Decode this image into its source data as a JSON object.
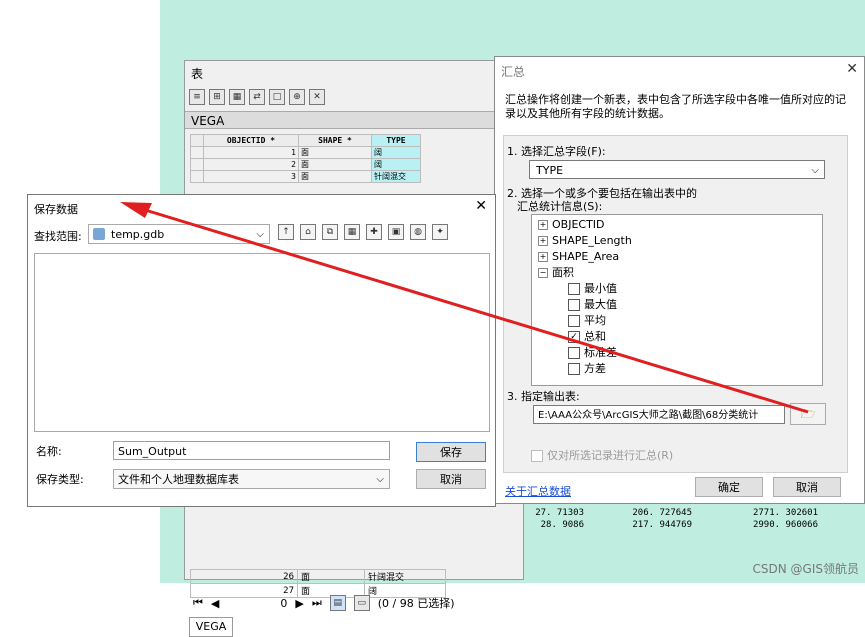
{
  "table_window": {
    "title": "表",
    "layer_name": "VEGA",
    "columns": [
      "OBJECTID *",
      "SHAPE *",
      "TYPE"
    ],
    "rows": [
      [
        "1",
        "面",
        "阔"
      ],
      [
        "2",
        "面",
        "阔"
      ],
      [
        "3",
        "面",
        "针阔混交"
      ]
    ],
    "bottom_rows": [
      [
        "26",
        "面",
        "针阔混交",
        "27. 71303",
        "206. 727645",
        "2771. 302601"
      ],
      [
        "27",
        "面",
        "阔",
        "28. 9086",
        "217. 944769",
        "2990. 960066"
      ]
    ],
    "nav_value": "0",
    "selection_status": "(0 / 98 已选择)",
    "tab": "VEGA"
  },
  "summarize_dialog": {
    "title": "汇总",
    "description": "汇总操作将创建一个新表，表中包含了所选字段中各唯一值所对应的记录以及其他所有字段的统计数据。",
    "step1_label": "1. 选择汇总字段(F):",
    "field_value": "TYPE",
    "step2_label_line1": "2. 选择一个或多个要包括在输出表中的",
    "step2_label_line2": "汇总统计信息(S):",
    "tree_fields": [
      "OBJECTID",
      "SHAPE_Length",
      "SHAPE_Area",
      "面积"
    ],
    "stat_items": [
      {
        "label": "最小值",
        "checked": false
      },
      {
        "label": "最大值",
        "checked": false
      },
      {
        "label": "平均",
        "checked": false
      },
      {
        "label": "总和",
        "checked": true
      },
      {
        "label": "标准差",
        "checked": false
      },
      {
        "label": "方差",
        "checked": false
      }
    ],
    "step3_label": "3. 指定输出表:",
    "output_path": "E:\\AAA公众号\\ArcGIS大师之路\\截图\\68分类统计",
    "selected_only_label": "仅对所选记录进行汇总(R)",
    "help_link": "关于汇总数据",
    "ok_label": "确定",
    "cancel_label": "取消"
  },
  "save_dialog": {
    "title": "保存数据",
    "look_in_label": "查找范围:",
    "look_in_value": "temp.gdb",
    "name_label": "名称:",
    "name_value": "Sum_Output",
    "type_label": "保存类型:",
    "type_value": "文件和个人地理数据库表",
    "save_label": "保存",
    "cancel_label": "取消"
  },
  "watermark": "CSDN @GIS领航员",
  "colors": {
    "map_bg": "#bfeee0",
    "arrow": "#e02020",
    "link": "#1a4fd6",
    "highlight": "#b8f0f4"
  }
}
